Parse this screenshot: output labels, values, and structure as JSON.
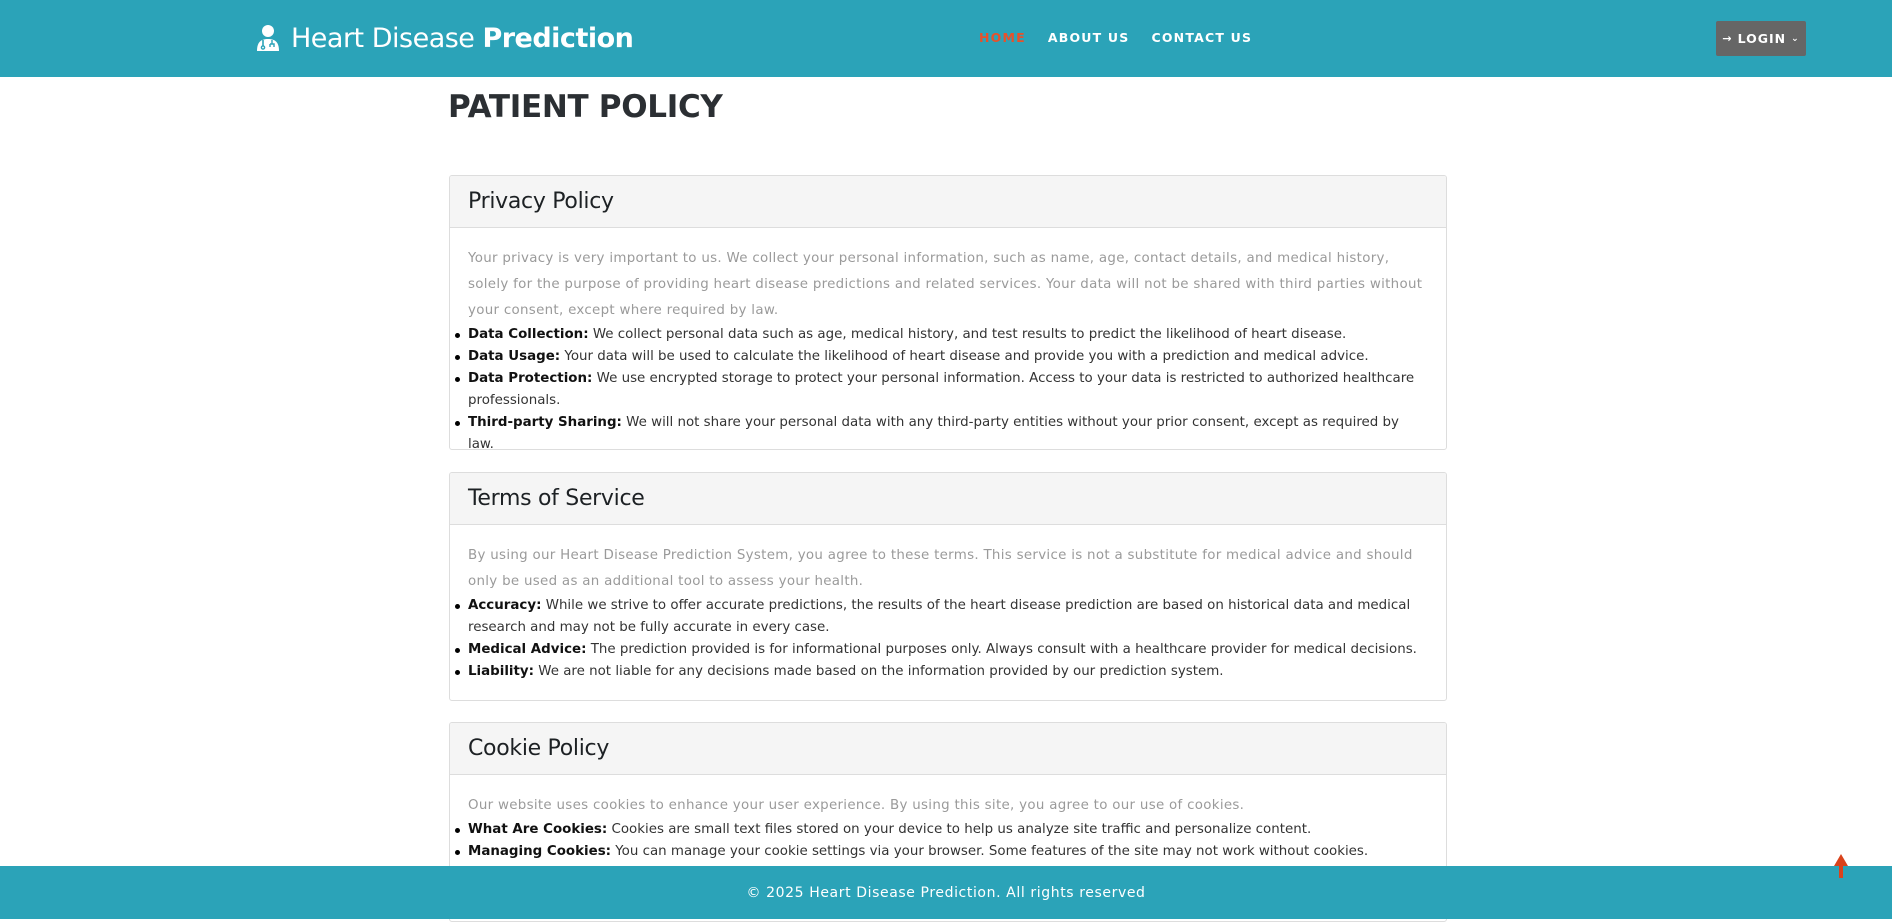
{
  "header": {
    "brand_light": "Heart Disease",
    "brand_bold": "Prediction",
    "nav": [
      {
        "label": "HOME",
        "active": true
      },
      {
        "label": "ABOUT US",
        "active": false
      },
      {
        "label": "CONTACT US",
        "active": false
      }
    ],
    "login_label": "LOGIN"
  },
  "main": {
    "title": "PATIENT POLICY",
    "sections": [
      {
        "heading": "Privacy Policy",
        "intro": "Your privacy is very important to us. We collect your personal information, such as name, age, contact details, and medical history, solely for the purpose of providing heart disease predictions and related services. Your data will not be shared with third parties without your consent, except where required by law.",
        "items": [
          {
            "term": "Data Collection:",
            "text": "We collect personal data such as age, medical history, and test results to predict the likelihood of heart disease."
          },
          {
            "term": "Data Usage:",
            "text": "Your data will be used to calculate the likelihood of heart disease and provide you with a prediction and medical advice."
          },
          {
            "term": "Data Protection:",
            "text": "We use encrypted storage to protect your personal information. Access to your data is restricted to authorized healthcare professionals."
          },
          {
            "term": "Third-party Sharing:",
            "text": "We will not share your personal data with any third-party entities without your prior consent, except as required by law."
          }
        ]
      },
      {
        "heading": "Terms of Service",
        "intro": "By using our Heart Disease Prediction System, you agree to these terms. This service is not a substitute for medical advice and should only be used as an additional tool to assess your health.",
        "items": [
          {
            "term": "Accuracy:",
            "text": "While we strive to offer accurate predictions, the results of the heart disease prediction are based on historical data and medical research and may not be fully accurate in every case."
          },
          {
            "term": "Medical Advice:",
            "text": "The prediction provided is for informational purposes only. Always consult with a healthcare provider for medical decisions."
          },
          {
            "term": "Liability:",
            "text": "We are not liable for any decisions made based on the information provided by our prediction system."
          }
        ]
      },
      {
        "heading": "Cookie Policy",
        "intro": "Our website uses cookies to enhance your user experience. By using this site, you agree to our use of cookies.",
        "items": [
          {
            "term": "What Are Cookies:",
            "text": "Cookies are small text files stored on your device to help us analyze site traffic and personalize content."
          },
          {
            "term": "Managing Cookies:",
            "text": "You can manage your cookie settings via your browser. Some features of the site may not work without cookies."
          }
        ]
      }
    ]
  },
  "footer": {
    "copyright": "© 2025 Heart Disease Prediction. All rights reserved"
  },
  "colors": {
    "header_bg": "#2ba3b8",
    "active_nav": "#e8512a",
    "login_bg": "#666666",
    "back_to_top": "#d9431c"
  },
  "icons": {
    "brand": "doctor-icon",
    "login": "sign-in-icon",
    "login_caret": "chevron-down-icon",
    "back_to_top": "arrow-up-icon"
  }
}
